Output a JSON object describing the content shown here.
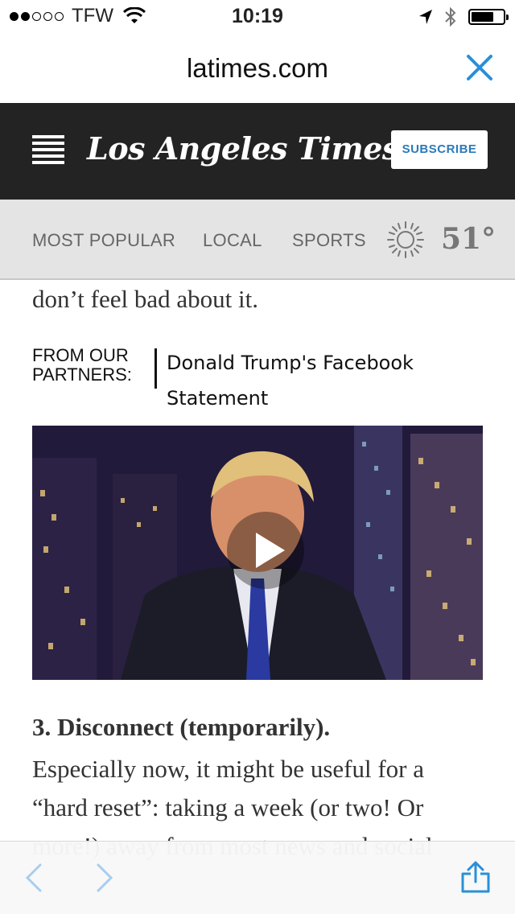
{
  "status_bar": {
    "signal_bars_filled": 2,
    "signal_bars_total": 5,
    "carrier": "TFW",
    "time": "10:19",
    "battery_level": 0.7
  },
  "browser": {
    "url": "latimes.com",
    "close_icon": "close-icon"
  },
  "masthead": {
    "logo": "Los Angeles Times",
    "subscribe_label": "SUBSCRIBE"
  },
  "section_nav": {
    "items": [
      "MOST POPULAR",
      "LOCAL",
      "SPORTS"
    ],
    "temperature": "51°",
    "weather_icon": "sun-icon"
  },
  "article": {
    "lead_text": "don’t feel bad about it.",
    "partners_label": "FROM OUR PARTNERS:",
    "partner_link": "Donald Trump's Facebook Statement",
    "heading": "3. Disconnect (temporarily).",
    "paragraph_line1": "Especially now, it might be useful for a",
    "paragraph_line2": "“hard reset”: taking a week (or two! Or",
    "paragraph_line3": "more!) away from most news and social"
  },
  "colors": {
    "masthead_bg": "#232323",
    "accent_blue": "#2a8fd8",
    "nav_bg": "#e4e4e4"
  }
}
